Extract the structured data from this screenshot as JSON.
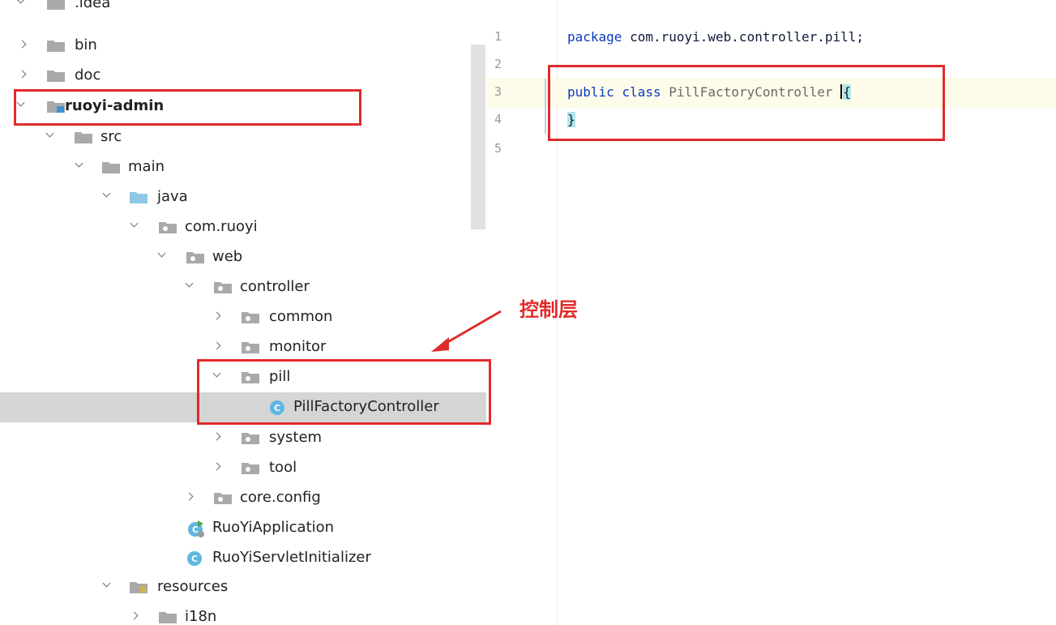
{
  "project_tree": {
    "items": [
      {
        "label": ".idea"
      },
      {
        "label": "bin"
      },
      {
        "label": "doc"
      },
      {
        "label": "ruoyi-admin"
      },
      {
        "label": "src"
      },
      {
        "label": "main"
      },
      {
        "label": "java"
      },
      {
        "label": "com.ruoyi"
      },
      {
        "label": "web"
      },
      {
        "label": "controller"
      },
      {
        "label": "common"
      },
      {
        "label": "monitor"
      },
      {
        "label": "pill"
      },
      {
        "label": "PillFactoryController"
      },
      {
        "label": "system"
      },
      {
        "label": "tool"
      },
      {
        "label": "core.config"
      },
      {
        "label": "RuoYiApplication"
      },
      {
        "label": "RuoYiServletInitializer"
      },
      {
        "label": "resources"
      },
      {
        "label": "i18n"
      }
    ]
  },
  "editor": {
    "line_numbers": [
      "1",
      "2",
      "3",
      "4",
      "5"
    ],
    "line1_keyword": "package",
    "line1_rest": " com.ruoyi.web.controller.pill;",
    "line3_kw1": "public",
    "line3_kw2": "class",
    "line3_name": "PillFactoryController",
    "line3_brace": "{",
    "line4_brace": "}"
  },
  "annotation": {
    "text": "控制层",
    "color": "#e02b2b"
  },
  "colors": {
    "highlight": "#e02b2b",
    "selected_row": "#d5d5d5",
    "keyword": "#0b3ac4"
  }
}
